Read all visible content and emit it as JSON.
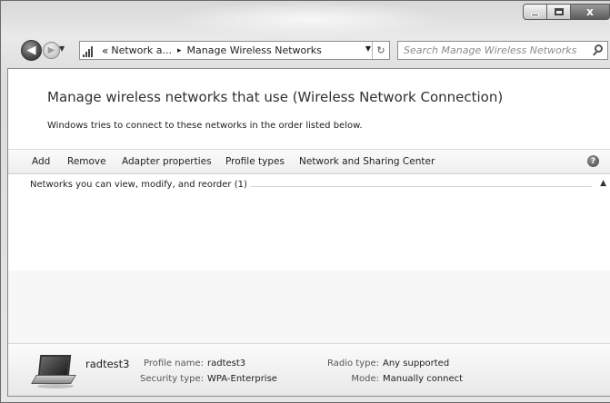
{
  "window": {
    "caption_buttons": {
      "minimize_icon": "minimize-icon",
      "maximize_icon": "maximize-icon",
      "close_glyph": "x"
    }
  },
  "navigation": {
    "back_glyph": "◀",
    "forward_glyph": "▶",
    "address": {
      "overflow": "«",
      "breadcrumbs": [
        "Network a...",
        "Manage Wireless Networks"
      ],
      "separator": "▸"
    },
    "refresh_glyph": "↻",
    "search_placeholder": "Search Manage Wireless Networks"
  },
  "main": {
    "heading": "Manage wireless networks that use (Wireless Network Connection)",
    "subtext": "Windows tries to connect to these networks in the order listed below."
  },
  "toolbar": {
    "items": [
      "Add",
      "Remove",
      "Adapter properties",
      "Profile types",
      "Network and Sharing Center"
    ],
    "help_glyph": "?"
  },
  "group": {
    "label": "Networks you can view, modify, and reorder (1)",
    "collapse_glyph": "▲"
  },
  "details": {
    "name": "radtest3",
    "profile_name_label": "Profile name:",
    "profile_name": "radtest3",
    "security_type_label": "Security type:",
    "security_type": "WPA-Enterprise",
    "radio_type_label": "Radio type:",
    "radio_type": "Any supported",
    "mode_label": "Mode:",
    "mode": "Manually connect"
  }
}
